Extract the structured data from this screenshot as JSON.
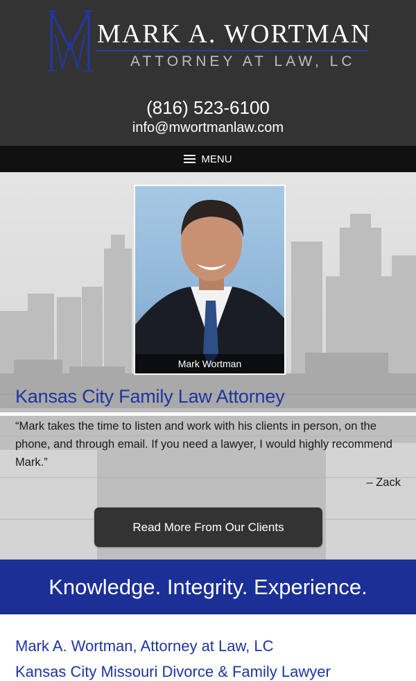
{
  "header": {
    "logo_first": "Mark A. Wortman",
    "logo_subtitle": "Attorney at Law, LC",
    "phone": "(816) 523-6100",
    "email": "info@mwortmanlaw.com"
  },
  "nav": {
    "menu_label": "MENU",
    "menu_icon": "hamburger-icon"
  },
  "hero": {
    "photo_caption": "Mark Wortman",
    "title": "Kansas City Family Law Attorney",
    "quote": "“Mark takes the time to listen and work with his clients in person, on the phone, and through email.  If you need a lawyer, I would highly recommend Mark.”",
    "quote_author": "– Zack",
    "cta_label": "Read More From Our Clients"
  },
  "tagline": "Knowledge. Integrity. Experience.",
  "footer": {
    "firm_name": "Mark A. Wortman, Attorney at Law, LC",
    "subtitle": "Kansas City Missouri Divorce & Family Lawyer"
  },
  "colors": {
    "header_bg": "#333333",
    "menu_bg": "#111111",
    "brand_blue": "#1b2f96",
    "title_blue": "#1d35a0"
  }
}
